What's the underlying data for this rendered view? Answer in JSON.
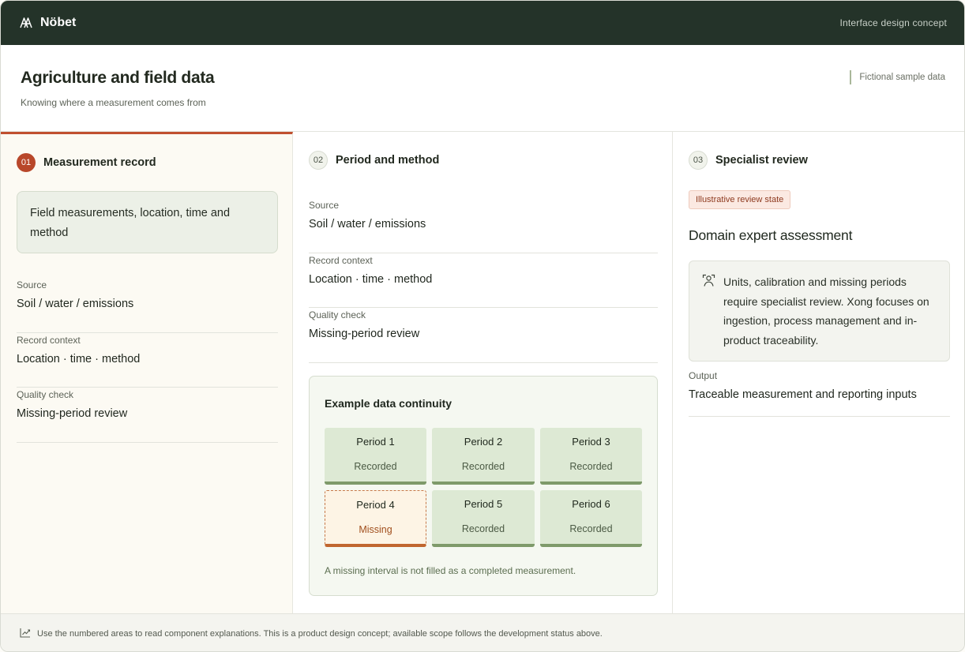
{
  "app": {
    "brand": "Nöbet",
    "concept_label": "Interface design concept",
    "brand_icon": "nobet-logo-icon"
  },
  "header": {
    "title": "Agriculture and field data",
    "subtitle": "Knowing where a measurement comes from",
    "sample_note": "Fictional sample data"
  },
  "columns": [
    {
      "number": "01",
      "title": "Measurement record",
      "callout": "Field measurements, location, time and method",
      "fields": [
        {
          "label": "Source",
          "value": "Soil / water / emissions"
        },
        {
          "label": "Record context",
          "value": "Location · time · method"
        },
        {
          "label": "Quality check",
          "value": "Missing-period review"
        }
      ]
    },
    {
      "number": "02",
      "title": "Period and method",
      "fields": [
        {
          "label": "Source",
          "value": "Soil / water / emissions"
        },
        {
          "label": "Record context",
          "value": "Location · time · method"
        },
        {
          "label": "Quality check",
          "value": "Missing-period review"
        }
      ],
      "continuity": {
        "title": "Example data continuity",
        "periods": [
          {
            "name": "Period 1",
            "status": "Recorded"
          },
          {
            "name": "Period 2",
            "status": "Recorded"
          },
          {
            "name": "Period 3",
            "status": "Recorded"
          },
          {
            "name": "Period 4",
            "status": "Missing"
          },
          {
            "name": "Period 5",
            "status": "Recorded"
          },
          {
            "name": "Period 6",
            "status": "Recorded"
          }
        ],
        "note": "A missing interval is not filled as a completed measurement."
      }
    },
    {
      "number": "03",
      "title": "Specialist review",
      "badge": "Illustrative review state",
      "assessment_title": "Domain expert assessment",
      "review_icon": "person-review-icon",
      "review_text": "Units, calibration and missing periods require specialist review. Xong focuses on ingestion, process management and in-product traceability.",
      "output_label": "Output",
      "output_value": "Traceable measurement and reporting inputs"
    }
  ],
  "footer": {
    "icon": "trend-chart-icon",
    "text": "Use the numbered areas to read component explanations. This is a product design concept; available scope follows the development status above."
  },
  "colors": {
    "topbar": "#243329",
    "accent": "#b8472a",
    "recorded": "#dde9d4",
    "missing_border": "#c0662f"
  }
}
